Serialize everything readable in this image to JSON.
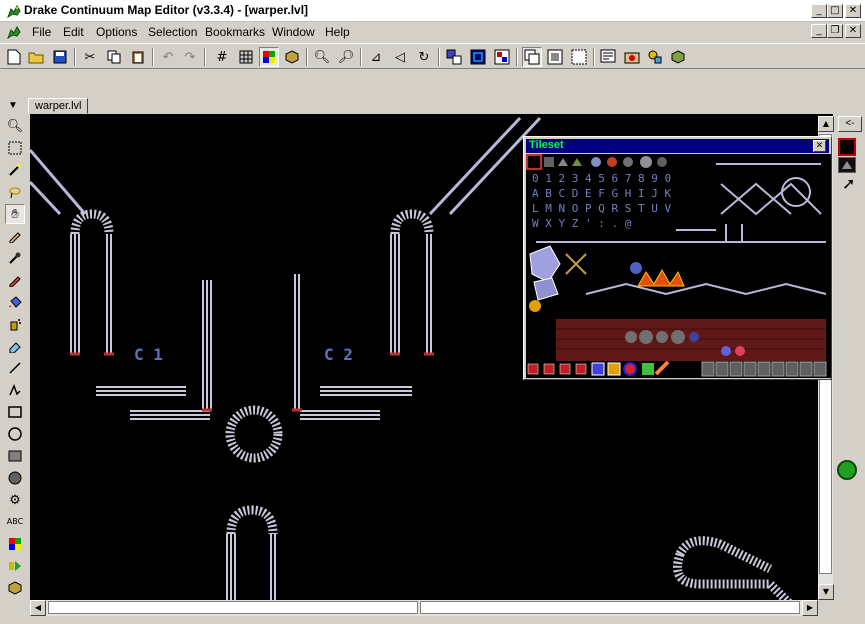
{
  "window": {
    "title": "Drake Continuum Map Editor (v3.3.4) - [warper.lvl]",
    "min": "_",
    "max": "□",
    "close": "✕",
    "restore": "❐"
  },
  "menu": [
    "File",
    "Edit",
    "Options",
    "Selection",
    "Bookmarks",
    "Window",
    "Help"
  ],
  "document": {
    "tab": "warper.lvl"
  },
  "tileset": {
    "title": "Tileset",
    "close": "✕",
    "rows": [
      "0 1 2 3 4 5 6 7 8 9 0",
      "A B C D E F G H I J K",
      "L M N O P Q R S T U V",
      "W X Y Z ' : . @"
    ]
  },
  "canvas_labels": [
    "C 1",
    "C 2"
  ],
  "side": {
    "back": "<-"
  },
  "colors": {
    "accent": "#000080",
    "tileset_title": "#00ff40",
    "map_bg": "#000000",
    "wall": "#b8b8c8"
  }
}
